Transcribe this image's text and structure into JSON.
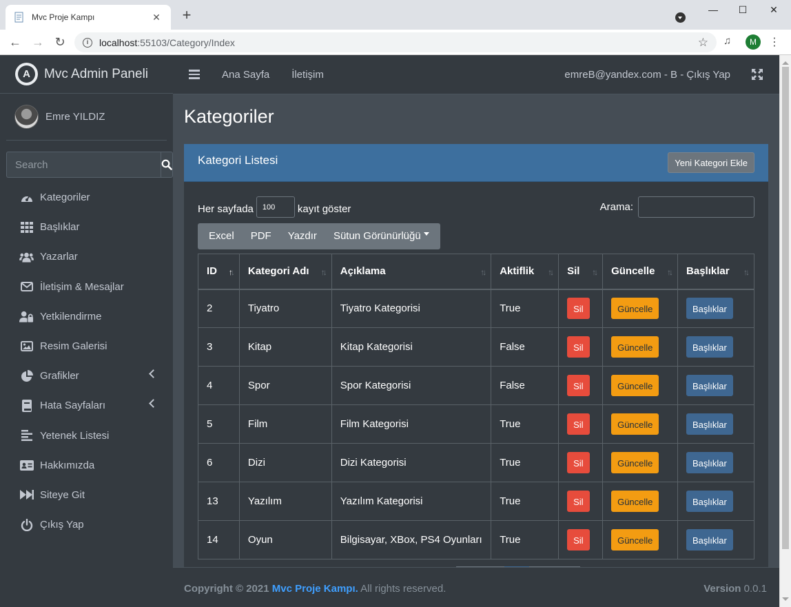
{
  "browser": {
    "tab_title": "Mvc Proje Kampı",
    "url_host": "localhost",
    "url_path": ":55103/Category/Index",
    "profile_initial": "M"
  },
  "sidebar": {
    "brand": "Mvc Admin Paneli",
    "user_name": "Emre YILDIZ",
    "search_placeholder": "Search",
    "items": [
      {
        "label": "Kategoriler",
        "icon": "gauge-icon"
      },
      {
        "label": "Başlıklar",
        "icon": "grid-icon"
      },
      {
        "label": "Yazarlar",
        "icon": "users-icon"
      },
      {
        "label": "İletişim & Mesajlar",
        "icon": "envelope-icon"
      },
      {
        "label": "Yetkilendirme",
        "icon": "user-lock-icon"
      },
      {
        "label": "Resim Galerisi",
        "icon": "image-icon"
      },
      {
        "label": "Grafikler",
        "icon": "pie-chart-icon",
        "has_submenu": true
      },
      {
        "label": "Hata Sayfaları",
        "icon": "book-icon",
        "has_submenu": true
      },
      {
        "label": "Yetenek Listesi",
        "icon": "align-left-icon"
      },
      {
        "label": "Hakkımızda",
        "icon": "id-card-icon"
      },
      {
        "label": "Siteye Git",
        "icon": "fast-forward-icon"
      },
      {
        "label": "Çıkış Yap",
        "icon": "power-icon"
      }
    ]
  },
  "topnav": {
    "home": "Ana Sayfa",
    "contact": "İletişim",
    "user_link": "emreB@yandex.com - B - Çıkış Yap"
  },
  "page": {
    "title": "Kategoriler",
    "card_title": "Kategori Listesi",
    "new_button": "Yeni Kategori Ekle"
  },
  "datatable": {
    "length_prefix": "Her sayfada",
    "length_value": "100",
    "length_suffix": "kayıt göster",
    "search_label": "Arama:",
    "buttons": [
      "Excel",
      "PDF",
      "Yazdır",
      "Sütun Görünürlüğü"
    ],
    "columns": [
      "ID",
      "Kategori Adı",
      "Açıklama",
      "Aktiflik",
      "Sil",
      "Güncelle",
      "Başlıklar"
    ],
    "rows": [
      {
        "id": "2",
        "name": "Tiyatro",
        "desc": "Tiyatro Kategorisi",
        "active": "True"
      },
      {
        "id": "3",
        "name": "Kitap",
        "desc": "Kitap Kategorisi",
        "active": "False"
      },
      {
        "id": "4",
        "name": "Spor",
        "desc": "Spor Kategorisi",
        "active": "False"
      },
      {
        "id": "5",
        "name": "Film",
        "desc": "Film Kategorisi",
        "active": "True"
      },
      {
        "id": "6",
        "name": "Dizi",
        "desc": "Dizi Kategorisi",
        "active": "True"
      },
      {
        "id": "13",
        "name": "Yazılım",
        "desc": "Yazılım Kategorisi",
        "active": "True"
      },
      {
        "id": "14",
        "name": "Oyun",
        "desc": "Bilgisayar, XBox, PS4 Oyunları",
        "active": "True"
      }
    ],
    "row_buttons": {
      "delete": "Sil",
      "update": "Güncelle",
      "headings": "Başlıklar"
    }
  },
  "footer": {
    "copyright": "Copyright © 2021",
    "site_link": "Mvc Proje Kampı.",
    "rights": "All rights reserved.",
    "version_label": "Version",
    "version": "0.0.1"
  },
  "colors": {
    "sidebar_bg": "#343a40",
    "content_bg": "#454d55",
    "card_header": "#3d6f9e",
    "danger": "#e74c3c",
    "warning": "#f39c12",
    "primary": "#3f6791"
  }
}
